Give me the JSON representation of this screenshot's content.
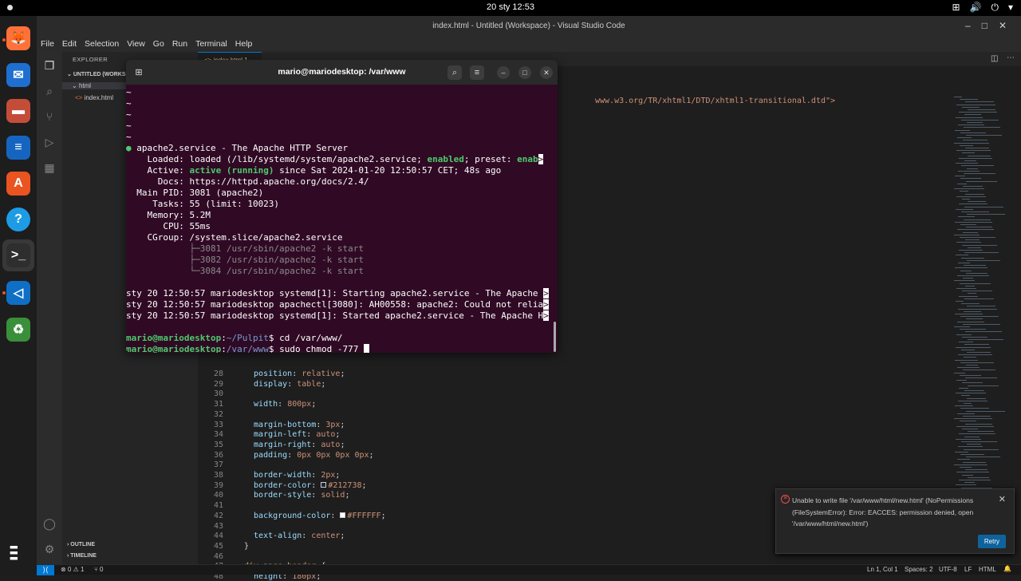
{
  "topbar": {
    "clock": "20 sty  12:53",
    "tray": [
      "⊞",
      "🔊",
      "⏻",
      "▾"
    ]
  },
  "dock": {
    "icons": [
      {
        "name": "firefox-icon",
        "glyph": "🦊",
        "bg": "#ff7139"
      },
      {
        "name": "thunderbird-icon",
        "glyph": "✉",
        "bg": "#1f6fd1"
      },
      {
        "name": "files-icon",
        "glyph": "▬",
        "bg": "#c44d3a"
      },
      {
        "name": "writer-icon",
        "glyph": "≡",
        "bg": "#1565c0"
      },
      {
        "name": "software-icon",
        "glyph": "A",
        "bg": "#e95420"
      },
      {
        "name": "help-icon",
        "glyph": "?",
        "bg": "#1d9ce5"
      },
      {
        "name": "terminal-icon",
        "glyph": ">_",
        "bg": "#2e2e2e"
      },
      {
        "name": "vscode-icon",
        "glyph": "◁",
        "bg": "#0f6fc5"
      },
      {
        "name": "trash-icon",
        "glyph": "♻",
        "bg": "#3a8f3a"
      }
    ],
    "apps_grid": "⋮⋮⋮"
  },
  "vscode": {
    "window_title": "index.html - Untitled (Workspace) - Visual Studio Code",
    "menu": [
      "File",
      "Edit",
      "Selection",
      "View",
      "Go",
      "Run",
      "Terminal",
      "Help"
    ],
    "explorer_title": "EXPLORER",
    "workspace": "UNTITLED (WORKS...",
    "folder": "html",
    "file": "index.html",
    "tab": "index.html 1",
    "outline": "OUTLINE",
    "timeline": "TIMELINE",
    "doctype_tail": "www.w3.org/TR/xhtml1/DTD/xhtml1-transitional.dtd\">",
    "code_lines": [
      {
        "n": "28",
        "indent": "  ",
        "prop": "position",
        "val": "relative"
      },
      {
        "n": "29",
        "indent": "  ",
        "prop": "display",
        "val": "table"
      },
      {
        "n": "30",
        "indent": "",
        "prop": "",
        "val": ""
      },
      {
        "n": "31",
        "indent": "  ",
        "prop": "width",
        "val": "800px"
      },
      {
        "n": "32",
        "indent": "",
        "prop": "",
        "val": ""
      },
      {
        "n": "33",
        "indent": "  ",
        "prop": "margin-bottom",
        "val": "3px"
      },
      {
        "n": "34",
        "indent": "  ",
        "prop": "margin-left",
        "val": "auto"
      },
      {
        "n": "35",
        "indent": "  ",
        "prop": "margin-right",
        "val": "auto"
      },
      {
        "n": "36",
        "indent": "  ",
        "prop": "padding",
        "val": "0px 0px 0px 0px"
      },
      {
        "n": "37",
        "indent": "",
        "prop": "",
        "val": ""
      },
      {
        "n": "38",
        "indent": "  ",
        "prop": "border-width",
        "val": "2px"
      },
      {
        "n": "39",
        "indent": "  ",
        "prop": "border-color",
        "val": "#212738",
        "swatch": "#212738"
      },
      {
        "n": "40",
        "indent": "  ",
        "prop": "border-style",
        "val": "solid"
      },
      {
        "n": "41",
        "indent": "",
        "prop": "",
        "val": ""
      },
      {
        "n": "42",
        "indent": "  ",
        "prop": "background-color",
        "val": "#FFFFFF",
        "swatch": "#FFFFFF"
      },
      {
        "n": "43",
        "indent": "",
        "prop": "",
        "val": ""
      },
      {
        "n": "44",
        "indent": "  ",
        "prop": "text-align",
        "val": "center"
      },
      {
        "n": "45",
        "indent": "",
        "raw": "}"
      },
      {
        "n": "46",
        "indent": "",
        "prop": "",
        "val": ""
      },
      {
        "n": "47",
        "indent": "",
        "raw": "div.page_header {"
      },
      {
        "n": "48",
        "indent": "  ",
        "prop": "height",
        "val": "180px"
      }
    ],
    "status": {
      "errors": "⊗ 0 ⚠ 1",
      "ports": "⑂ 0",
      "position": "Ln 1, Col 1",
      "spaces": "Spaces: 2",
      "encoding": "UTF-8",
      "eol": "LF",
      "language": "HTML"
    },
    "notification": {
      "message": "Unable to write file '/var/www/html/new.html' (NoPermissions (FileSystemError): Error: EACCES: permission denied, open '/var/www/html/new.html')",
      "button": "Retry"
    }
  },
  "terminal": {
    "title": "mario@mariodesktop: /var/www",
    "tildes": [
      "~",
      "~",
      "~",
      "~",
      "~"
    ],
    "service_line": "apache2.service - The Apache HTTP Server",
    "loaded_label": "    Loaded: ",
    "loaded_value": "loaded (/lib/systemd/system/apache2.service; ",
    "enabled": "enabled",
    "preset": "; preset: ",
    "preset_val": "enab",
    "active_label": "    Active: ",
    "active_value": "active (running)",
    "active_rest": " since Sat 2024-01-20 12:50:57 CET; 48s ago",
    "docs": "      Docs: https://httpd.apache.org/docs/2.4/",
    "mainpid": "  Main PID: 3081 (apache2)",
    "tasks": "     Tasks: 55 (limit: 10023)",
    "memory": "    Memory: 5.2M",
    "cpu": "       CPU: 55ms",
    "cgroup": "    CGroup: /system.slice/apache2.service",
    "procs": [
      "            ├─3081 /usr/sbin/apache2 -k start",
      "            ├─3082 /usr/sbin/apache2 -k start",
      "            └─3084 /usr/sbin/apache2 -k start"
    ],
    "logs": [
      "sty 20 12:50:57 mariodesktop systemd[1]: Starting apache2.service - The Apache ",
      "sty 20 12:50:57 mariodesktop apachectl[3080]: AH00558: apache2: Could not relia",
      "sty 20 12:50:57 mariodesktop systemd[1]: Started apache2.service - The Apache H"
    ],
    "prompt_user": "mario@mariodesktop",
    "prompt1_path": "~/Pulpit",
    "cmd1": "$ cd /var/www/",
    "prompt2_path": "/var/www",
    "cmd2": "$ sudo chmod -777 "
  },
  "colors": {
    "terminal_bg": "#300a24",
    "accent": "#0078d4",
    "ubuntu_orange": "#e95420"
  }
}
